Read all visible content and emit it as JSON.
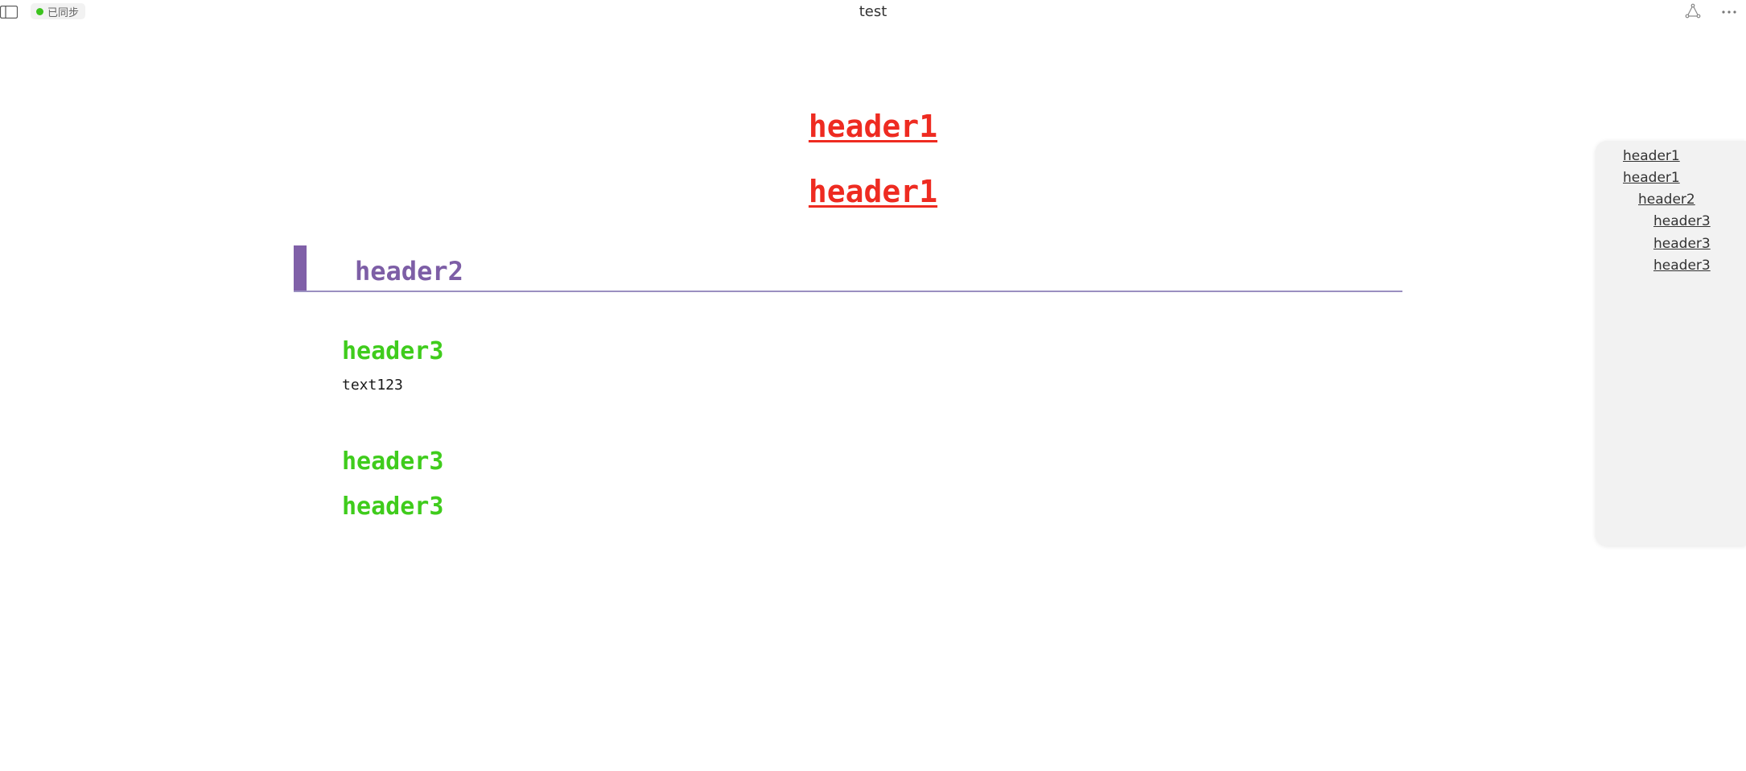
{
  "topbar": {
    "sidebar_toggle_icon": "sidebar-panel-icon",
    "sync_status": "已同步",
    "sync_color": "#3cc31e",
    "title": "test",
    "graph_icon": "graph-icon",
    "more_icon": "more-horizontal-icon"
  },
  "content": {
    "h1_a": "header1",
    "h1_b": "header1",
    "h2": "header2",
    "h3_a": "header3",
    "text": "text123",
    "h3_b": "header3",
    "h3_c": "header3"
  },
  "outline": {
    "items": [
      {
        "label": "header1",
        "level": 1
      },
      {
        "label": "header1",
        "level": 1
      },
      {
        "label": "header2",
        "level": 2
      },
      {
        "label": "header3",
        "level": 3
      },
      {
        "label": "header3",
        "level": 3
      },
      {
        "label": "header3",
        "level": 3
      }
    ]
  },
  "colors": {
    "h1": "#ee2b21",
    "h2": "#7d5ea6",
    "h2_bar": "#8060a8",
    "h3": "#3fcc1c"
  }
}
